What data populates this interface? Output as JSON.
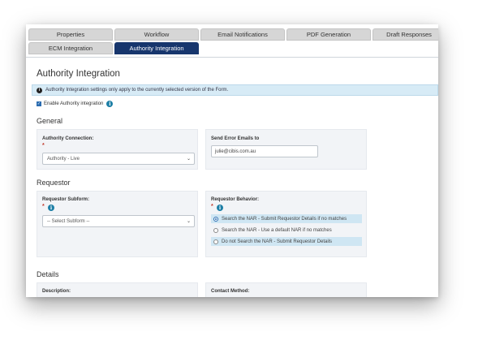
{
  "tabs_row1": [
    "Properties",
    "Workflow",
    "Email Notifications",
    "PDF Generation",
    "Draft Responses"
  ],
  "tabs_row2": [
    "ECM Integration",
    "Authority Integration"
  ],
  "active_tab": "Authority Integration",
  "page_title": "Authority Integration",
  "info_text": "Authority Integration settings only apply to the currently selected version of the Form.",
  "enable_label": "Enable Authority integration",
  "sections": {
    "general": "General",
    "requestor": "Requestor",
    "details": "Details"
  },
  "general": {
    "connection_label": "Authority Connection:",
    "connection_value": "Authority - Live",
    "error_emails_label": "Send Error Emails to",
    "error_emails_value": "julie@cibis.com.au"
  },
  "requestor": {
    "subform_label": "Requestor Subform:",
    "subform_value": "-- Select Subform --",
    "behavior_label": "Requestor Behavior:",
    "behaviors": [
      "Search the NAR - Submit Requestor Details if no matches",
      "Search the NAR - Use a default NAR if no matches",
      "Do not Search the NAR - Submit Requestor Details"
    ],
    "selected_behavior": 0
  },
  "details": {
    "description_label": "Description:",
    "contact_method_label": "Contact Method:"
  },
  "required_mark": "*",
  "help_glyph": "i",
  "info_glyph": "i"
}
